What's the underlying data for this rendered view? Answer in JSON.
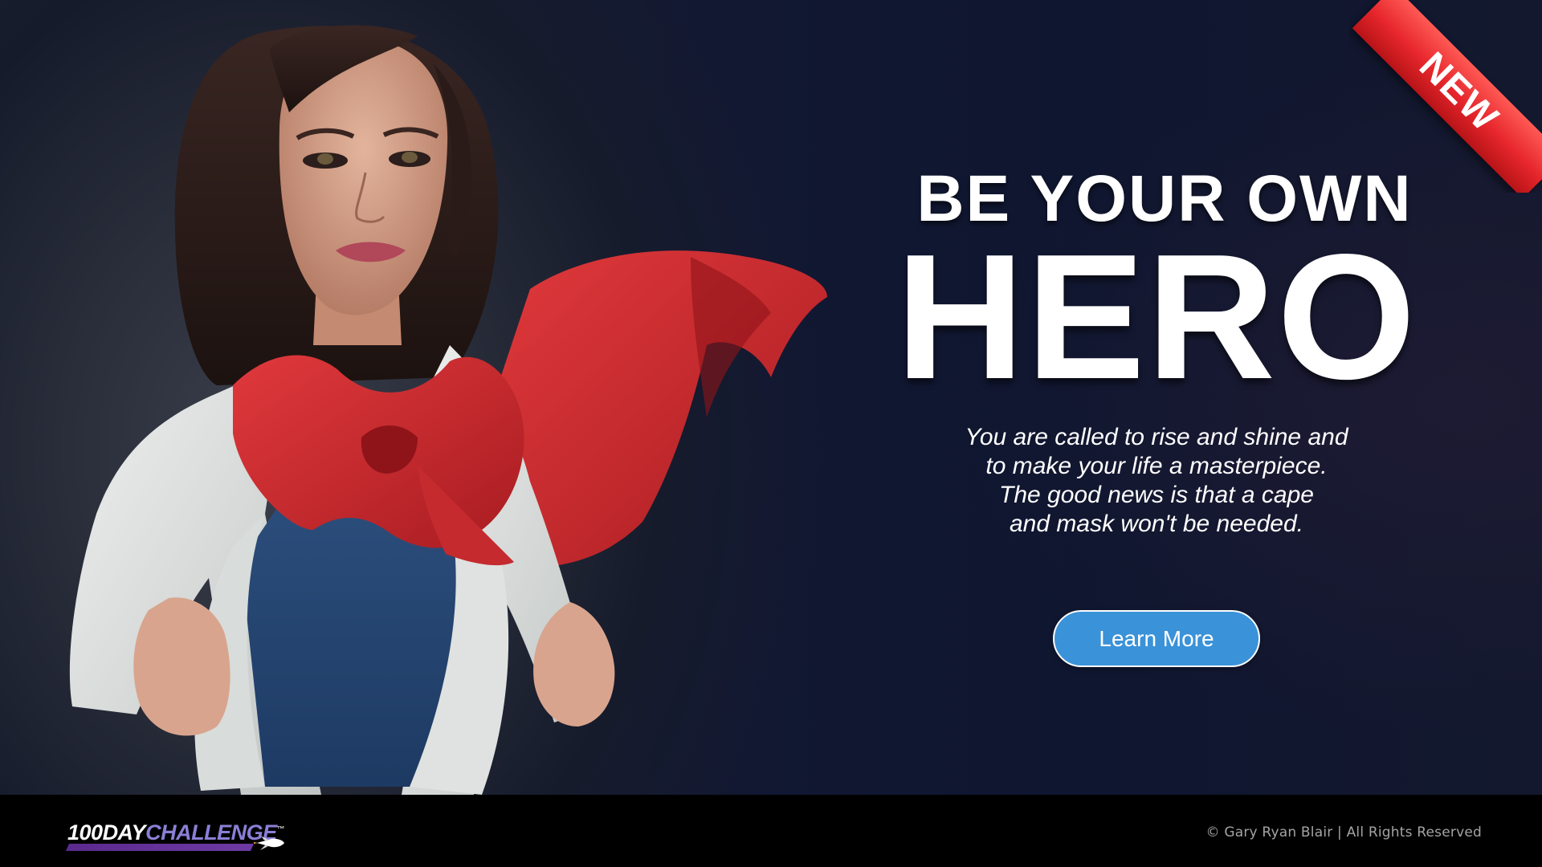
{
  "ribbon": {
    "label": "NEW",
    "color": "#e6262c"
  },
  "hero": {
    "headline_small": "BE YOUR OWN",
    "headline_big": "HERO",
    "tagline_lines": [
      "You are called to rise and shine and",
      "to make your life a masterpiece.",
      "The good news is that a cape",
      "and mask won't be needed."
    ],
    "cta_label": "Learn More",
    "cta_color": "#3a92d9",
    "image": "woman-opening-shirt-with-red-cape-photo"
  },
  "footer": {
    "logo": {
      "part1": "100",
      "part2": "DAY",
      "part3": "CHALLENGE",
      "mark": "™",
      "icon": "rocket-icon"
    },
    "copyright": "© Gary Ryan Blair  |  All Rights Reserved"
  }
}
